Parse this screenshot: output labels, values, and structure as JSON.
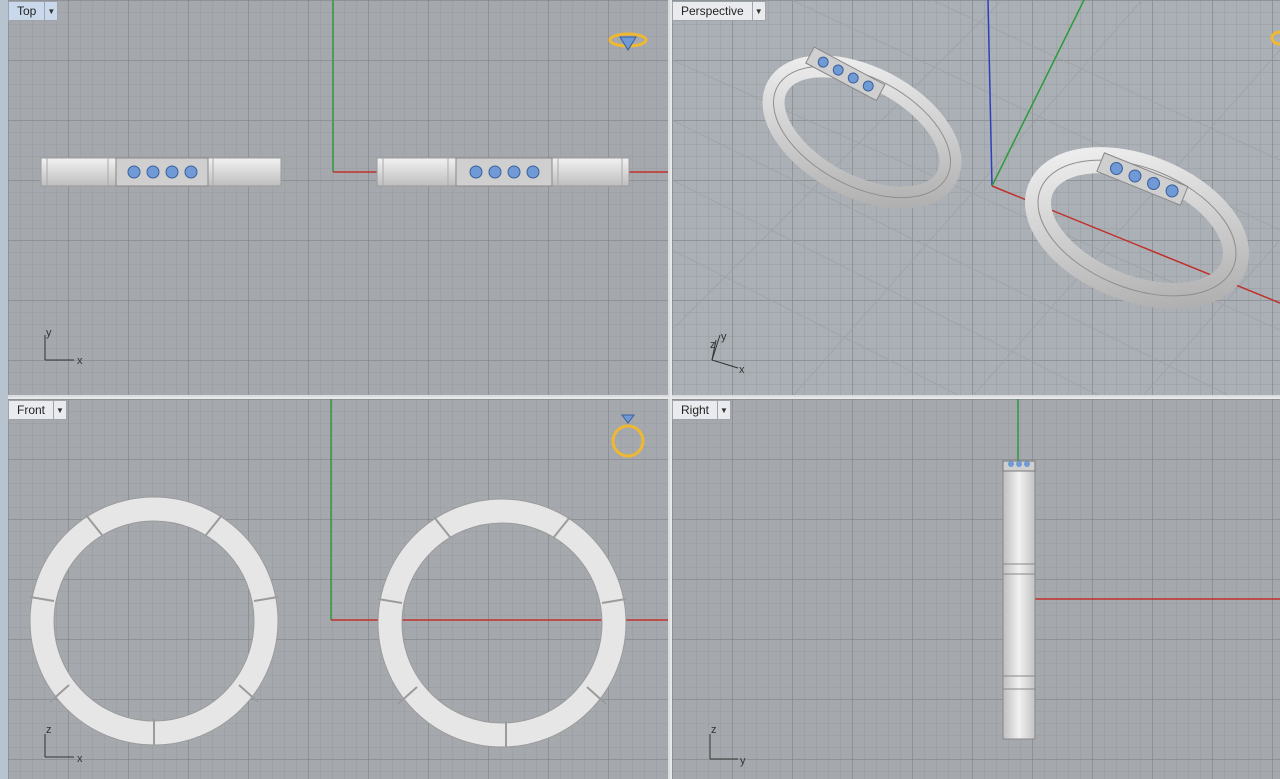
{
  "viewports": {
    "top": {
      "title": "Top",
      "axis_h": "x",
      "axis_v": "y",
      "dropdown_icon": "caret-down-icon"
    },
    "persp": {
      "title": "Perspective",
      "axis_h": "x",
      "axis_v": "y",
      "axis_z": "z",
      "dropdown_icon": "caret-down-icon"
    },
    "front": {
      "title": "Front",
      "axis_h": "x",
      "axis_v": "z",
      "dropdown_icon": "caret-down-icon"
    },
    "right": {
      "title": "Right",
      "axis_h": "y",
      "axis_v": "z",
      "dropdown_icon": "caret-down-icon"
    }
  },
  "colors": {
    "grid_bg": "#a5a9ad",
    "x_axis": "#c0302c",
    "y_axis": "#2e9a3a",
    "z_axis": "#2d3fc0",
    "metal": "#e6e6e6",
    "gem": "#6f9ad6",
    "gumball_icon": "#f0b830"
  }
}
